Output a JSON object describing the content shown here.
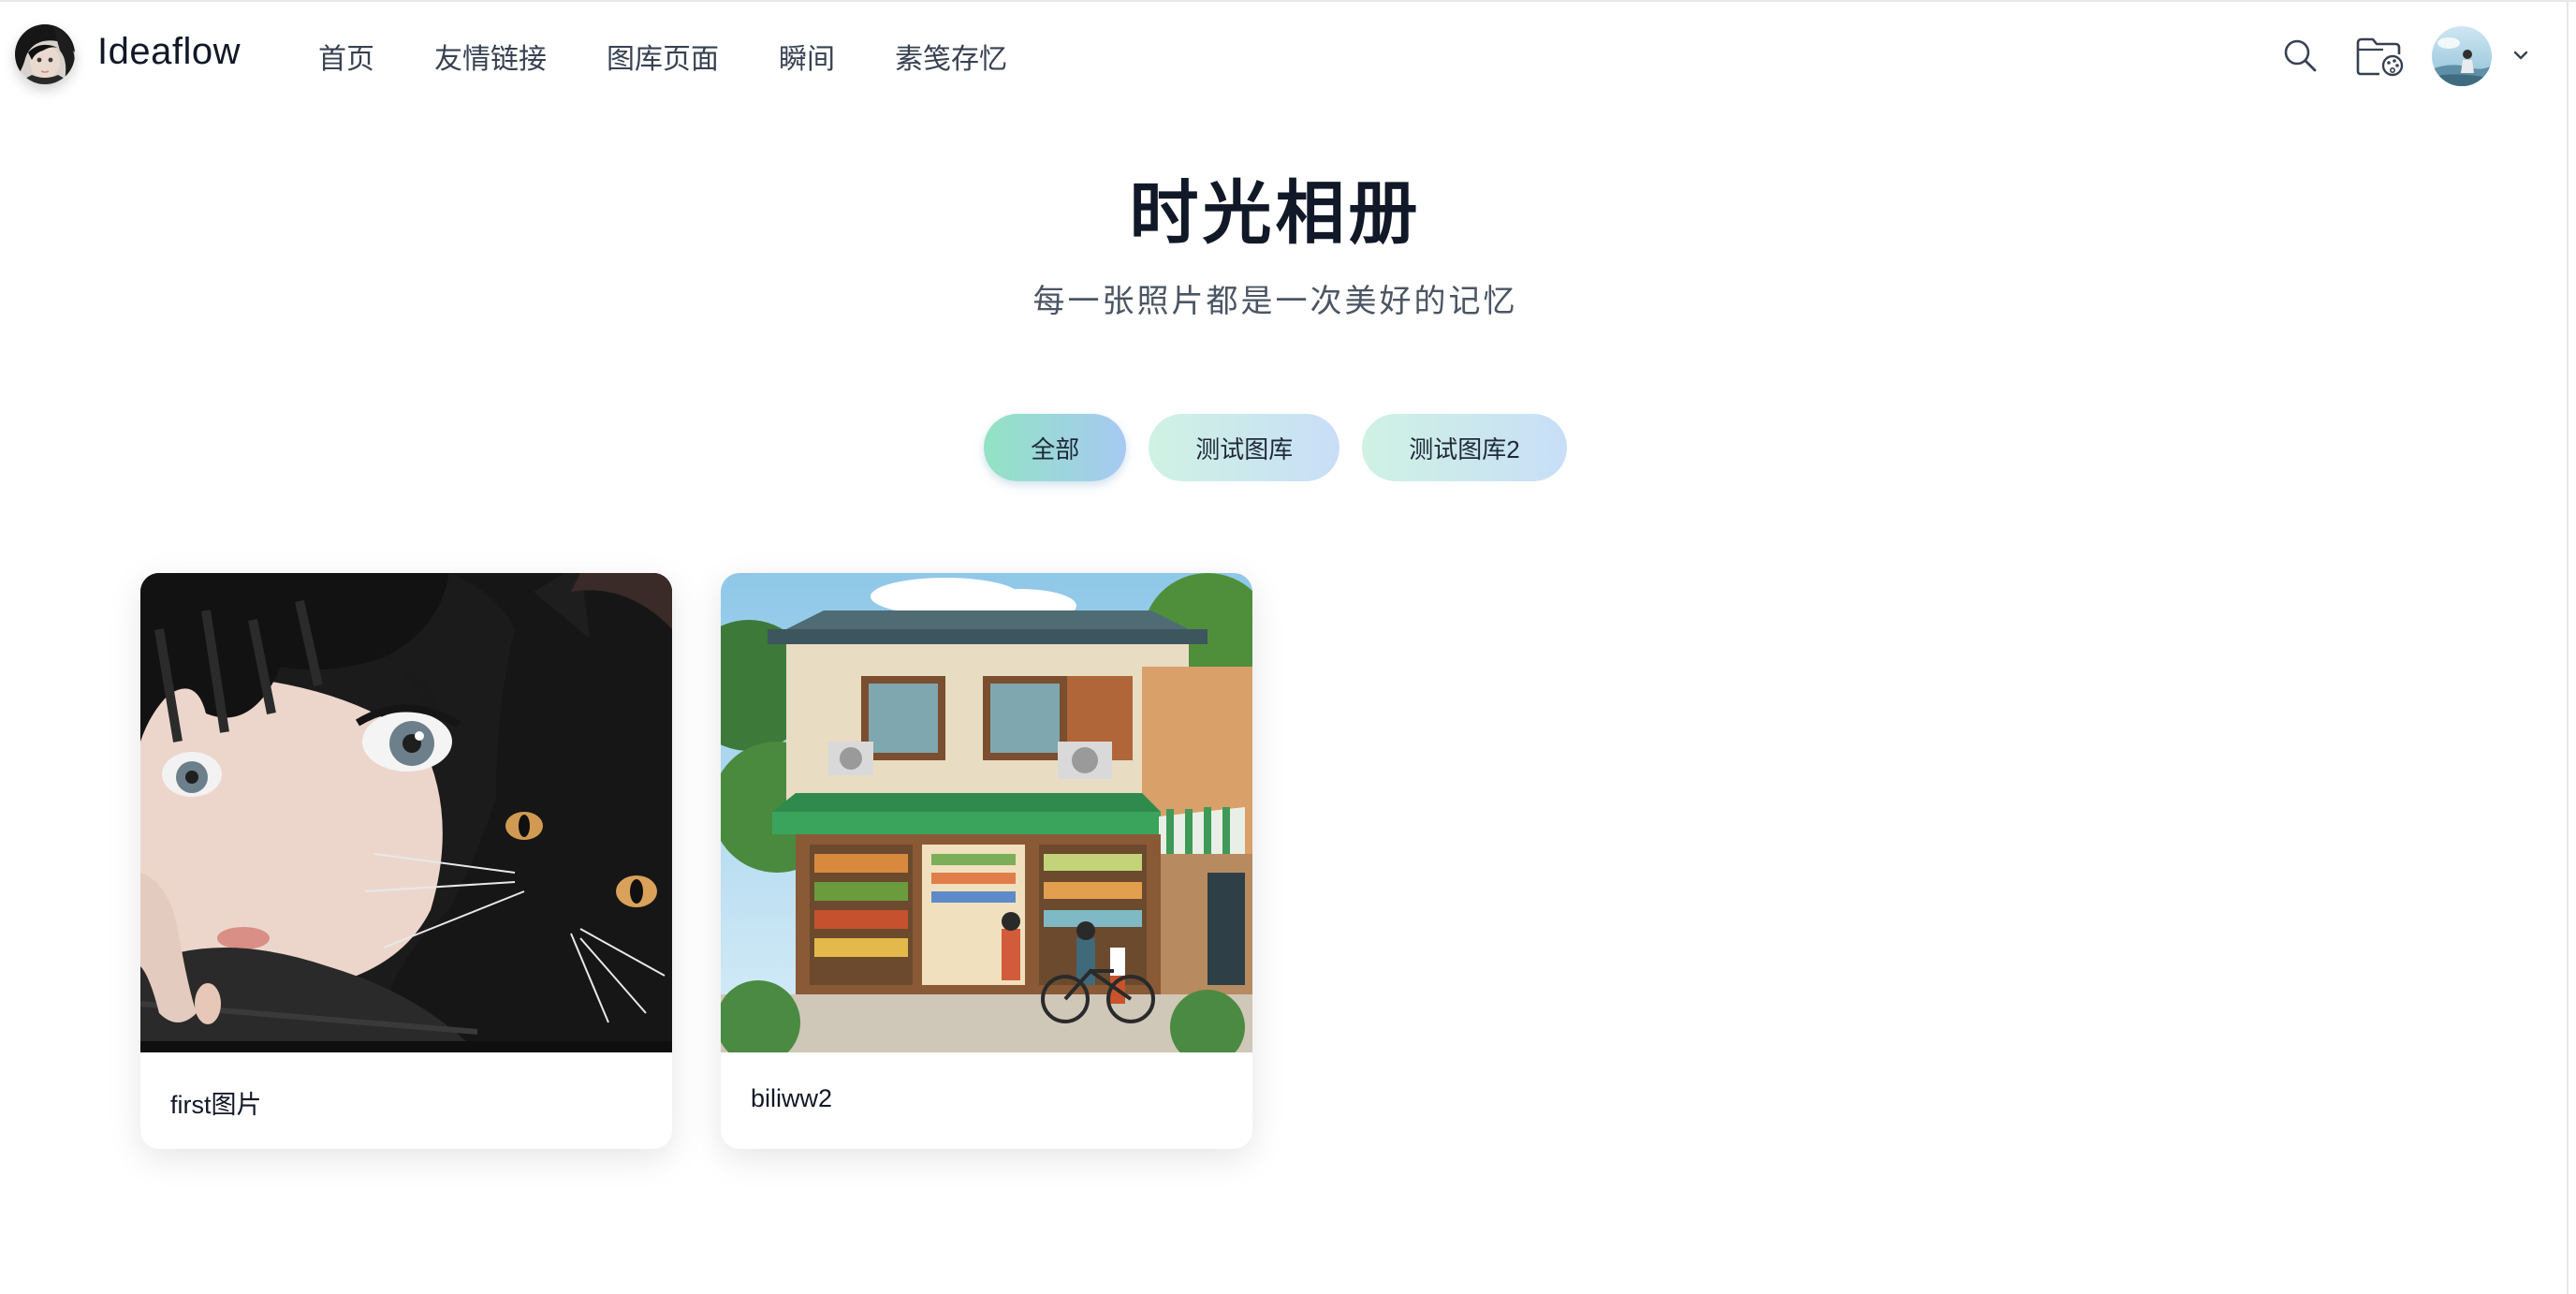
{
  "header": {
    "brand": "Ideaflow",
    "nav": [
      "首页",
      "友情链接",
      "图库页面",
      "瞬间",
      "素笺存忆"
    ],
    "icons": [
      "search-icon",
      "folder-palette-icon",
      "avatar",
      "chevron-down-icon"
    ]
  },
  "hero": {
    "title": "时光相册",
    "subtitle": "每一张照片都是一次美好的记忆"
  },
  "filters": [
    {
      "label": "全部",
      "active": true
    },
    {
      "label": "测试图库",
      "active": false
    },
    {
      "label": "测试图库2",
      "active": false
    }
  ],
  "gallery": [
    {
      "caption": "first图片"
    },
    {
      "caption": "biliww2"
    }
  ],
  "colors": {
    "pill_active_from": "#92e3c3",
    "pill_active_to": "#a7c9f3",
    "pill_idle_from": "#cff2e3",
    "pill_idle_to": "#c8def7",
    "title": "#111827"
  }
}
